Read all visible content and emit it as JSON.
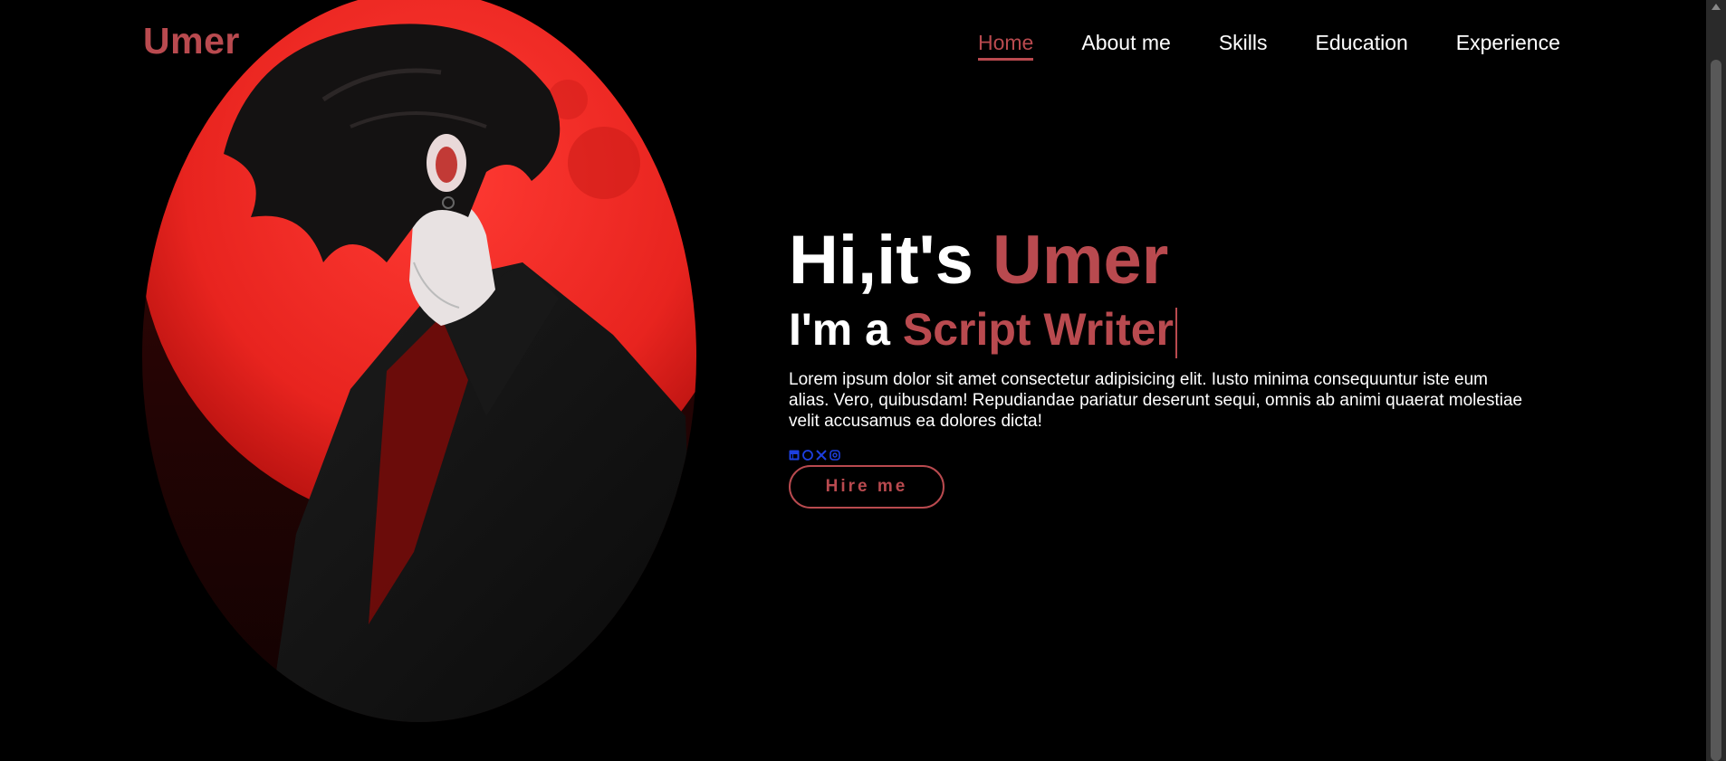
{
  "header": {
    "logo": "Umer",
    "nav": [
      "Home",
      "About me",
      "Skills",
      "Education",
      "Experience"
    ]
  },
  "hero": {
    "greeting_prefix": "Hi,it's ",
    "name": "Umer",
    "role_prefix": "I'm a ",
    "role": "Script Writer",
    "description": "Lorem ipsum dolor sit amet consectetur adipisicing elit. Iusto minima consequuntur iste eum alias. Vero, quibusdam! Repudiandae pariatur deserunt sequi, omnis ab animi quaerat molestiae velit accusamus ea dolores dicta!",
    "button": "Hire me",
    "social_icons": [
      "linkedin-icon",
      "github-icon",
      "x-icon",
      "instagram-icon"
    ]
  },
  "colors": {
    "accent": "#b94a4f",
    "background": "#000000",
    "text": "#ffffff"
  }
}
